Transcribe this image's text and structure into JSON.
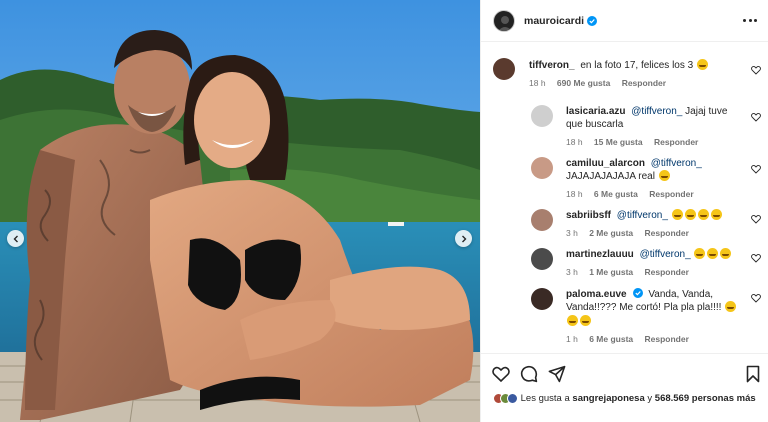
{
  "post": {
    "author": "mauroicardi",
    "verified": true,
    "more_icon": "more-horizontal-icon"
  },
  "comments": [
    {
      "user": "tiffveron_",
      "text": "en la foto 17, felices los 3",
      "emoji_count": 1,
      "time": "18 h",
      "likes": "690 Me gusta",
      "reply": "Responder",
      "avatar_color": "#5a3a2e"
    },
    {
      "user": "lasicaria.azu",
      "mention": "@tiffveron_",
      "text": "Jajaj tuve que buscarla",
      "time": "18 h",
      "likes": "15 Me gusta",
      "reply": "Responder",
      "avatar_color": "#cfcfcf"
    },
    {
      "user": "camiluu_alarcon",
      "mention": "@tiffveron_",
      "text": "JAJAJAJAJAJA real",
      "emoji_count": 1,
      "time": "18 h",
      "likes": "6 Me gusta",
      "reply": "Responder",
      "avatar_color": "#c89a86"
    },
    {
      "user": "sabriibsff",
      "mention": "@tiffveron_",
      "emoji_count": 4,
      "time": "3 h",
      "likes": "2 Me gusta",
      "reply": "Responder",
      "avatar_color": "#a87f6e"
    },
    {
      "user": "martinezlauuu",
      "mention": "@tiffveron_",
      "emoji_count": 3,
      "time": "3 h",
      "likes": "1 Me gusta",
      "reply": "Responder",
      "avatar_color": "#4b4b4b"
    },
    {
      "user": "paloma.euve",
      "verified": true,
      "text": "Vanda, Vanda, Vanda!!??? Me cortó! Pla pla pla!!!!",
      "emoji_count_inline": 1,
      "emoji_count_after": 2,
      "time": "1 h",
      "likes": "6 Me gusta",
      "reply": "Responder",
      "avatar_color": "#3a2a25"
    }
  ],
  "likes_summary": {
    "prefix": "Les gusta a",
    "user": "sangrejaponesa",
    "joiner": "y",
    "count": "568.569 personas",
    "suffix": "más"
  },
  "actions": {
    "like_icon": "heart-icon",
    "comment_icon": "comment-icon",
    "share_icon": "share-icon",
    "save_icon": "bookmark-icon"
  },
  "colors": {
    "verified": "#0095f6",
    "mention": "#00376b",
    "muted": "#737373"
  }
}
